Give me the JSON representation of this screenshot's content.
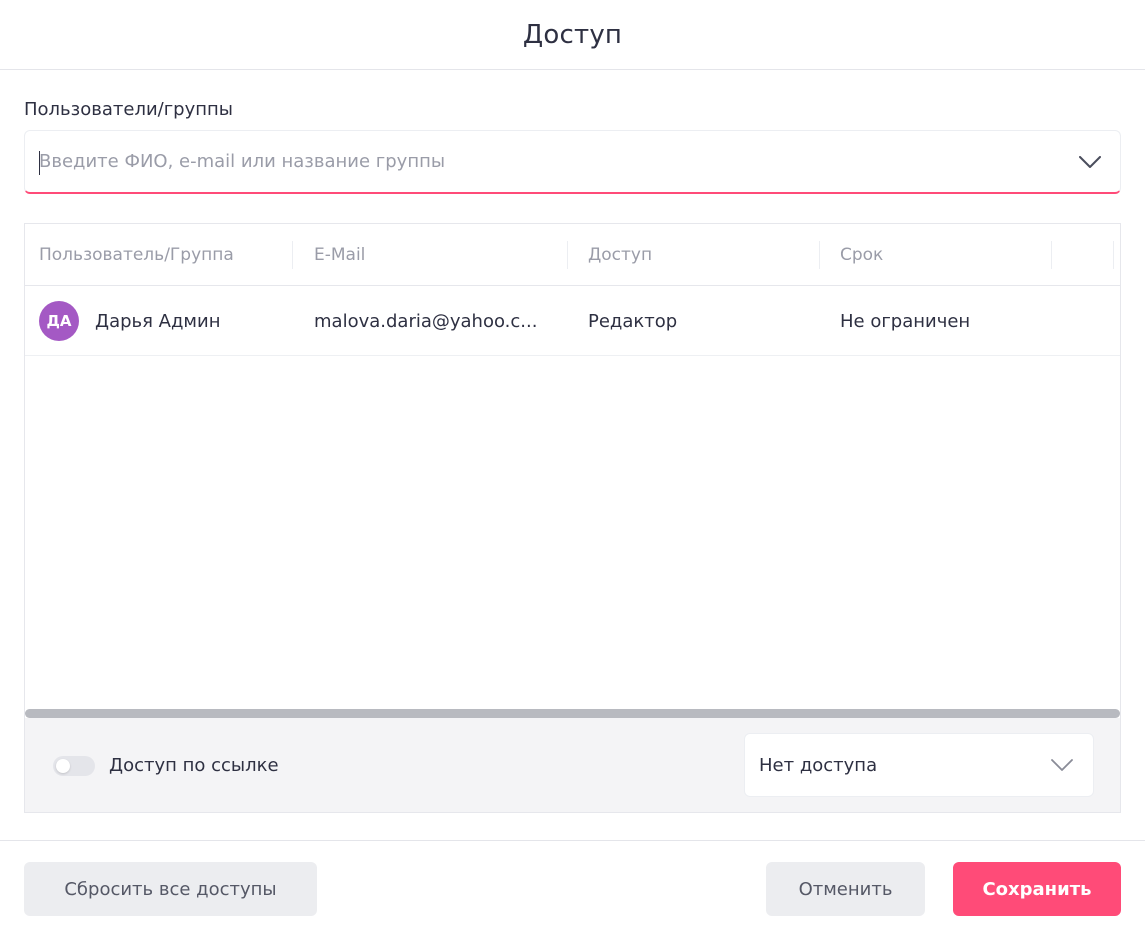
{
  "dialog": {
    "title": "Доступ"
  },
  "users_field": {
    "label": "Пользователи/группы",
    "placeholder": "Введите ФИО, e-mail или название группы",
    "value": "",
    "icon": "chevron-down-icon"
  },
  "table": {
    "columns": [
      "Пользователь/Группа",
      "E-Mail",
      "Доступ",
      "Срок"
    ],
    "rows": [
      {
        "avatar_initials": "ДА",
        "avatar_color": "#a459c4",
        "name": "Дарья Админ",
        "email": "malova.daria@yahoo.c...",
        "access": "Редактор",
        "term": "Не ограничен"
      }
    ]
  },
  "link_access": {
    "label": "Доступ по ссылке",
    "enabled": false,
    "select_value": "Нет доступа",
    "icon": "chevron-down-icon"
  },
  "buttons": {
    "reset": "Сбросить все доступы",
    "cancel": "Отменить",
    "save": "Сохранить"
  },
  "colors": {
    "accent": "#ff4b78",
    "secondary_button": "#ecedf0",
    "muted_text": "#9a9ca8"
  }
}
